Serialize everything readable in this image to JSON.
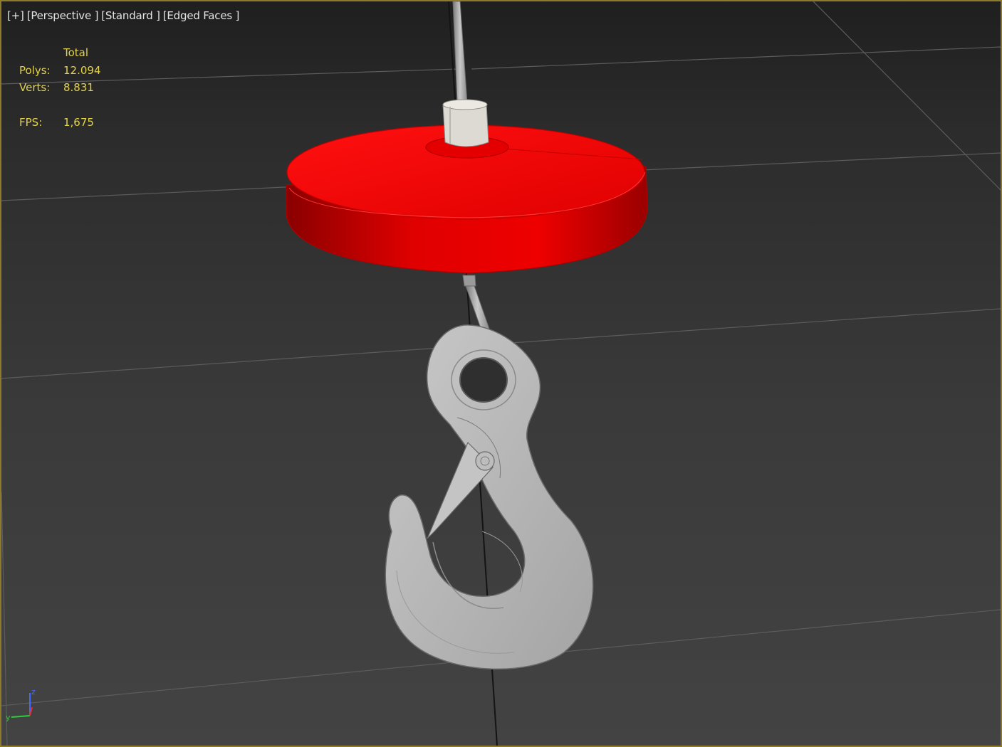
{
  "viewport": {
    "labels": [
      "[+]",
      "[Perspective ]",
      "[Standard ]",
      "[Edged Faces ]"
    ]
  },
  "stats": {
    "header": "Total",
    "polys_label": "Polys:",
    "polys_value": "12.094",
    "verts_label": "Verts:",
    "verts_value": "8.831",
    "fps_label": "FPS:",
    "fps_value": "1,675"
  },
  "gizmo": {
    "z": "z",
    "y": "y"
  },
  "colors": {
    "border": "#8f7a2a",
    "stats_text": "#e3d34a",
    "label_text": "#e4e4e4",
    "hoist_red": "#e00000",
    "hook_grey": "#b8b8b8",
    "grid_line": "#5c5c5c",
    "axis_x": "#2ecc40",
    "axis_y": "#2ecc40",
    "axis_z": "#3f6cff"
  },
  "icons": [
    "viewport-menu-icon",
    "view-axis-gizmo-icon"
  ]
}
